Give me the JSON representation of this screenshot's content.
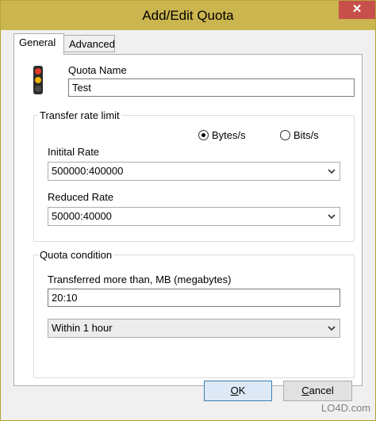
{
  "window": {
    "title": "Add/Edit Quota",
    "close_glyph": "✕"
  },
  "tabs": [
    {
      "label": "General",
      "active": true
    },
    {
      "label": "Advanced",
      "active": false
    }
  ],
  "quota_name": {
    "label": "Quota Name",
    "value": "Test",
    "icon": "traffic-light-icon"
  },
  "transfer_rate": {
    "group_title": "Transfer rate limit",
    "unit_options": [
      {
        "label": "Bytes/s",
        "selected": true
      },
      {
        "label": "Bits/s",
        "selected": false
      }
    ],
    "initial_rate_label": "Initital Rate",
    "initial_rate_value": "500000:400000",
    "reduced_rate_label": "Reduced Rate",
    "reduced_rate_value": "50000:40000"
  },
  "quota_condition": {
    "group_title": "Quota condition",
    "transferred_label": "Transferred more than, MB (megabytes)",
    "transferred_value": "20:10",
    "period_value": "Within 1 hour"
  },
  "buttons": {
    "ok_mnemonic": "O",
    "ok_rest": "K",
    "cancel_mnemonic": "C",
    "cancel_rest": "ancel"
  },
  "watermark": {
    "text": "LO4D.com"
  },
  "colors": {
    "titlebar": "#cbb54f",
    "close": "#c7504b",
    "default_button_border": "#3c7fb1"
  }
}
